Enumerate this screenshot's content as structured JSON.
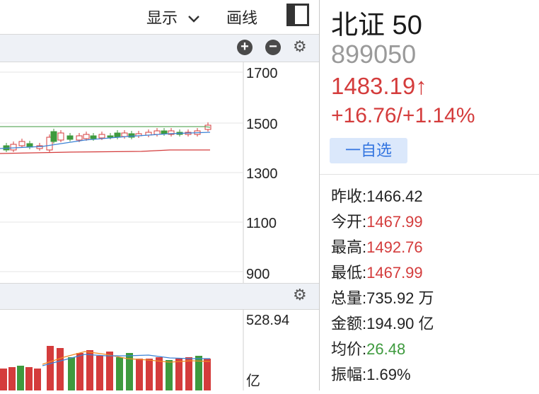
{
  "header": {
    "display_label": "显示",
    "draw_label": "画线"
  },
  "main_chart": {
    "axis_labels": [
      "1700",
      "1500",
      "1300",
      "1100",
      "900"
    ]
  },
  "volume_chart": {
    "max_label": "528.94",
    "unit_label": "亿"
  },
  "colors": {
    "up": "#d43c3c",
    "down": "#3e9a3e",
    "accent": "#3375e0"
  },
  "quote": {
    "name": "北证 50",
    "code": "899050",
    "price": "1483.19↑",
    "change": "+16.76/+1.14%",
    "watch_label": "一自选",
    "stats": [
      {
        "label": "昨收:",
        "value": "1466.42",
        "tone": "dark"
      },
      {
        "label": "今开:",
        "value": "1467.99",
        "tone": "red"
      },
      {
        "label": "最高:",
        "value": "1492.76",
        "tone": "red"
      },
      {
        "label": "最低:",
        "value": "1467.99",
        "tone": "red"
      },
      {
        "label": "总量:",
        "value": "735.92 万",
        "tone": "dark"
      },
      {
        "label": "金额:",
        "value": "194.90 亿",
        "tone": "dark"
      },
      {
        "label": "均价:",
        "value": "26.48",
        "tone": "green"
      },
      {
        "label": "振幅:",
        "value": "1.69%",
        "tone": "dark"
      }
    ]
  }
}
